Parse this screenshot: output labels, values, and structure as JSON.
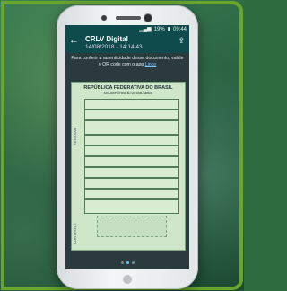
{
  "status": {
    "battery": "19%",
    "time": "09:44"
  },
  "header": {
    "title": "CRLV Digital",
    "timestamp": "14/08/2018 - 14:14:43"
  },
  "info": {
    "text": "Para conferir a autenticidade desse documento, valide o QR code com o app",
    "link": "Lince"
  },
  "document": {
    "heading": "REPÚBLICA FEDERATIVA DO BRASIL",
    "subheading": "MINISTÉRIO DAS CIDADES",
    "side_label_top": "RENAVAM",
    "side_label_bottom": "CONTROLE"
  },
  "icons": {
    "back": "arrow-left-icon",
    "share": "share-icon"
  },
  "pager": {
    "count": 3,
    "active": 1
  }
}
